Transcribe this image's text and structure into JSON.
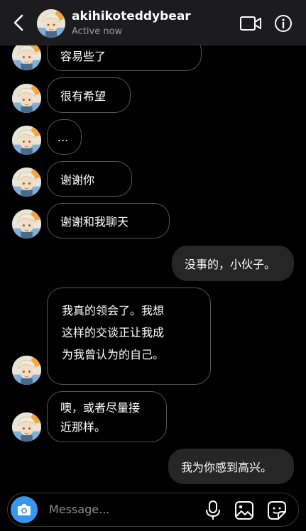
{
  "header": {
    "username": "akihikoteddybear",
    "status": "Active now"
  },
  "messages": {
    "m1": "容易些了",
    "m2": "很有希望",
    "m3": "...",
    "m4": "谢谢你",
    "m5": "谢谢和我聊天",
    "m6": "没事的，小伙子。",
    "m7_line1": "我真的领会了。我想",
    "m7_line2": "这样的交谈正让我成",
    "m7_line3": "为我曾认为的自己。",
    "m8_line1": "噢，或者尽量接",
    "m8_line2": "近那样。",
    "m9": "我为你感到高兴。"
  },
  "composer": {
    "placeholder": "Message..."
  },
  "colors": {
    "background": "#000000",
    "header": "#1c1c1e",
    "outgoing_bubble": "#262626",
    "incoming_border": "#555555",
    "camera_button": "#3797f0"
  },
  "icons": [
    "back-arrow-icon",
    "video-call-icon",
    "info-icon",
    "camera-icon",
    "microphone-icon",
    "gallery-icon",
    "sticker-icon"
  ]
}
